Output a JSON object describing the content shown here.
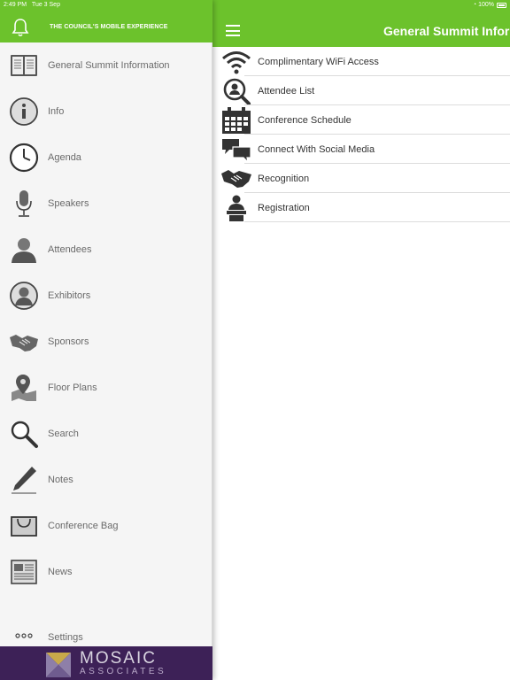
{
  "status_bar": {
    "time": "2:49 PM",
    "date": "Tue 3 Sep",
    "battery": "100%"
  },
  "drawer": {
    "title": "THE COUNCIL'S MOBILE EXPERIENCE",
    "items": [
      {
        "label": "General Summit Information",
        "icon": "book-icon"
      },
      {
        "label": "Info",
        "icon": "info-icon"
      },
      {
        "label": "Agenda",
        "icon": "clock-icon"
      },
      {
        "label": "Speakers",
        "icon": "microphone-icon"
      },
      {
        "label": "Attendees",
        "icon": "person-icon"
      },
      {
        "label": "Exhibitors",
        "icon": "person-circle-icon"
      },
      {
        "label": "Sponsors",
        "icon": "handshake-icon"
      },
      {
        "label": "Floor Plans",
        "icon": "map-pin-icon"
      },
      {
        "label": "Search",
        "icon": "magnifier-icon"
      },
      {
        "label": "Notes",
        "icon": "pen-icon"
      },
      {
        "label": "Conference Bag",
        "icon": "bag-icon"
      },
      {
        "label": "News",
        "icon": "newspaper-icon"
      },
      {
        "label": "Settings",
        "icon": "more-dots-icon"
      }
    ],
    "brand": {
      "name": "MOSAIC",
      "sub": "ASSOCIATES"
    }
  },
  "main": {
    "title": "General Summit Information",
    "items": [
      {
        "label": "Complimentary WiFi Access",
        "icon": "wifi-icon"
      },
      {
        "label": "Attendee List",
        "icon": "attendee-search-icon"
      },
      {
        "label": "Conference Schedule",
        "icon": "calendar-icon"
      },
      {
        "label": "Connect With Social Media",
        "icon": "chat-bubbles-icon"
      },
      {
        "label": "Recognition",
        "icon": "handshake-icon"
      },
      {
        "label": "Registration",
        "icon": "podium-icon"
      }
    ]
  },
  "colors": {
    "header_green": "#6cc22c",
    "brand_purple": "#3d2157",
    "drawer_bg": "#f5f5f5"
  }
}
